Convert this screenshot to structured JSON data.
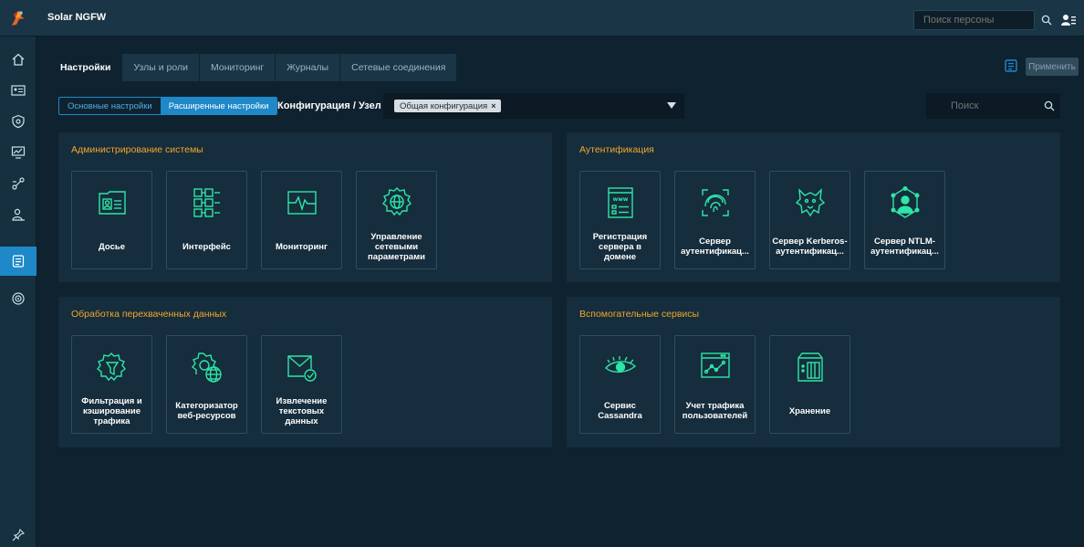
{
  "app": {
    "title": "Solar NGFW"
  },
  "topbar": {
    "person_search_placeholder": "Поиск персоны"
  },
  "sidebar": {
    "items": [
      {
        "icon": "home-icon"
      },
      {
        "icon": "id-card-icon"
      },
      {
        "icon": "shield-icon"
      },
      {
        "icon": "monitor-chart-icon"
      },
      {
        "icon": "network-icon"
      },
      {
        "icon": "user-group-icon"
      },
      {
        "icon": "settings-list-icon",
        "active": true
      },
      {
        "icon": "globe-icon"
      }
    ],
    "pin_icon": "pin-icon"
  },
  "tabs": [
    {
      "label": "Настройки",
      "active": true
    },
    {
      "label": "Узлы и роли"
    },
    {
      "label": "Мониторинг"
    },
    {
      "label": "Журналы"
    },
    {
      "label": "Сетевые соединения"
    }
  ],
  "toolbar": {
    "apply_label": "Применить"
  },
  "mode": {
    "basic_label": "Основные настройки",
    "advanced_label": "Расширенные настройки"
  },
  "config": {
    "label": "Конфигурация / Узел",
    "chip": "Общая конфигурация",
    "chip_remove": "×"
  },
  "search": {
    "placeholder": "Поиск"
  },
  "colors": {
    "accent": "#1e88c9",
    "section_title": "#f2a82b",
    "icon": "#2ee6a6"
  },
  "sections": {
    "admin": {
      "title": "Администрирование системы",
      "cards": [
        "Досье",
        "Интерфейс",
        "Мониторинг",
        "Управление сетевыми параметрами"
      ]
    },
    "auth": {
      "title": "Аутентификация",
      "cards": [
        "Регистрация сервера в домене",
        "Сервер аутентификац...",
        "Сервер Kerberos-аутентификац...",
        "Сервер NTLM-аутентификац..."
      ]
    },
    "intercept": {
      "title": "Обработка перехваченных данных",
      "cards": [
        "Фильтрация и кэширование трафика",
        "Категоризатор веб-ресурсов",
        "Извлечение текстовых данных"
      ]
    },
    "aux": {
      "title": "Вспомогательные сервисы",
      "cards": [
        "Сервис Cassandra",
        "Учет трафика пользователей",
        "Хранение"
      ]
    }
  }
}
